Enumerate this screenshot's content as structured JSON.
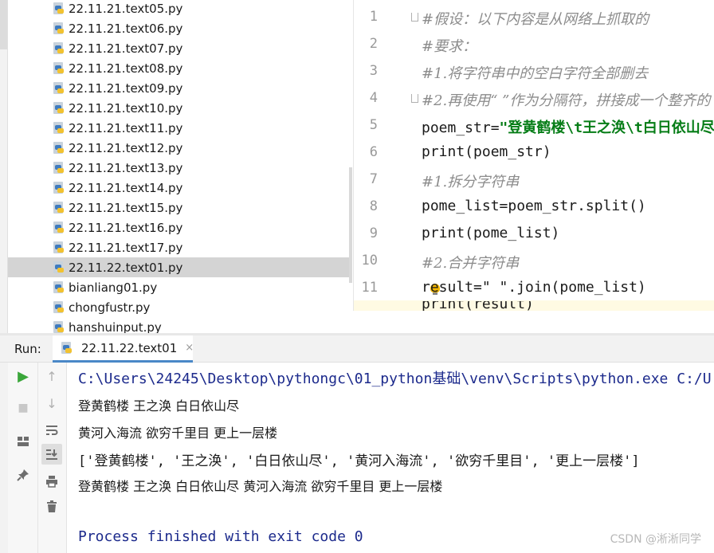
{
  "project_tree": {
    "items": [
      {
        "label": "22.11.21.text05.py",
        "selected": false
      },
      {
        "label": "22.11.21.text06.py",
        "selected": false
      },
      {
        "label": "22.11.21.text07.py",
        "selected": false
      },
      {
        "label": "22.11.21.text08.py",
        "selected": false
      },
      {
        "label": "22.11.21.text09.py",
        "selected": false
      },
      {
        "label": "22.11.21.text10.py",
        "selected": false
      },
      {
        "label": "22.11.21.text11.py",
        "selected": false
      },
      {
        "label": "22.11.21.text12.py",
        "selected": false
      },
      {
        "label": "22.11.21.text13.py",
        "selected": false
      },
      {
        "label": "22.11.21.text14.py",
        "selected": false
      },
      {
        "label": "22.11.21.text15.py",
        "selected": false
      },
      {
        "label": "22.11.21.text16.py",
        "selected": false
      },
      {
        "label": "22.11.21.text17.py",
        "selected": false
      },
      {
        "label": "22.11.22.text01.py",
        "selected": true
      },
      {
        "label": "bianliang01.py",
        "selected": false
      },
      {
        "label": "chongfustr.py",
        "selected": false
      },
      {
        "label": "hanshuinput.py",
        "selected": false
      }
    ]
  },
  "editor": {
    "lines": [
      {
        "num": "1",
        "text": "#假设：以下内容是从网络上抓取的",
        "kind": "comment"
      },
      {
        "num": "2",
        "text": "#要求：",
        "kind": "comment"
      },
      {
        "num": "3",
        "text": "#1.将字符串中的空白字符全部删去",
        "kind": "comment"
      },
      {
        "num": "4",
        "text": "#2.再使用“ ”作为分隔符，拼接成一个整齐的",
        "kind": "comment"
      },
      {
        "num": "5",
        "code": "poem_str=",
        "str": "\"登黄鹤楼\\t王之涣\\t白日依山尽",
        "kind": "code"
      },
      {
        "num": "6",
        "text": "print(poem_str)",
        "kind": "code"
      },
      {
        "num": "7",
        "text": "#1.拆分字符串",
        "kind": "comment"
      },
      {
        "num": "8",
        "text": "pome_list=poem_str.split()",
        "kind": "code"
      },
      {
        "num": "9",
        "text": "print(pome_list)",
        "kind": "code"
      },
      {
        "num": "10",
        "text": "#2.合并字符串",
        "kind": "comment"
      },
      {
        "num": "11",
        "text": "result=\" \".join(pome_list)",
        "kind": "code"
      }
    ],
    "partial_line": "print(result)",
    "bulb_icon": "lightbulb-icon"
  },
  "run_panel": {
    "label": "Run:",
    "tab_label": "22.11.22.text01",
    "tab_close": "×"
  },
  "console": {
    "path_line": "C:\\Users\\24245\\Desktop\\pythongc\\01_python基础\\venv\\Scripts\\python.exe C:/U",
    "output_lines": [
      "登黄鹤楼  王之涣     白日依山尽",
      "黄河入海流            欲穷千里目      更上一层楼"
    ],
    "list_line": "['登黄鹤楼', '王之涣', '白日依山尽', '黄河入海流', '欲穷千里目', '更上一层楼']",
    "joined_line": "登黄鹤楼 王之涣 白日依山尽 黄河入海流 欲穷千里目 更上一层楼",
    "exit_line": "Process finished with exit code 0"
  },
  "watermark": "CSDN @淅淅同学",
  "colors": {
    "console_path": "#1c2a8c",
    "string_literal": "#067d17",
    "comment": "#8c8c8c",
    "run_button": "#3aa63a",
    "selection": "#d4d4d4"
  }
}
